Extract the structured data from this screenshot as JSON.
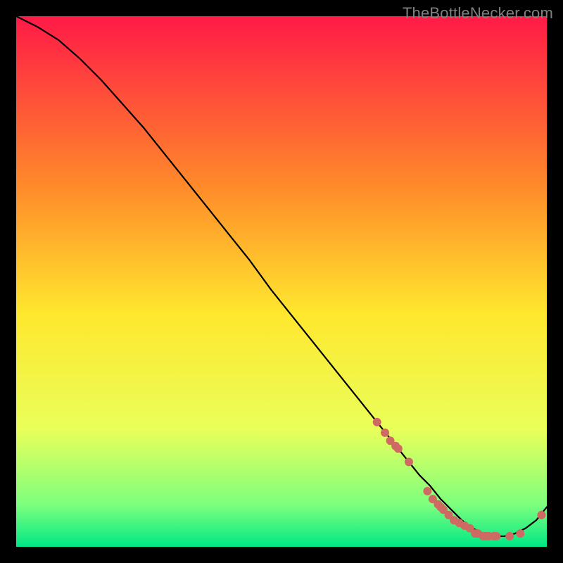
{
  "watermark": "TheBottleNecker.com",
  "colors": {
    "background": "#000000",
    "gradient_top": "#ff1a47",
    "gradient_mid_upper": "#ff8a2a",
    "gradient_mid": "#ffe72e",
    "gradient_mid_lower": "#e9ff5a",
    "gradient_lower": "#7eff7e",
    "gradient_bottom": "#00e884",
    "curve": "#000000",
    "marker": "#cf6a62"
  },
  "chart_data": {
    "type": "line",
    "title": "",
    "xlabel": "",
    "ylabel": "",
    "xlim": [
      0,
      100
    ],
    "ylim": [
      0,
      100
    ],
    "grid": false,
    "legend": false,
    "curve": {
      "x": [
        0,
        4,
        8,
        12,
        16,
        20,
        24,
        28,
        32,
        36,
        40,
        44,
        48,
        52,
        56,
        60,
        64,
        68,
        72,
        76,
        78,
        80,
        82,
        84,
        86,
        88,
        90,
        92,
        94,
        96,
        98,
        100
      ],
      "y": [
        100,
        98,
        95.5,
        92,
        88,
        83.5,
        79,
        74,
        69,
        64,
        59,
        54,
        48.5,
        43.5,
        38.5,
        33.5,
        28.5,
        23.5,
        18.5,
        13.5,
        11.5,
        9,
        7,
        5,
        3.5,
        2.5,
        2,
        2,
        2.5,
        3.5,
        5,
        7.5
      ]
    },
    "markers": {
      "x": [
        68,
        69.5,
        70.5,
        71.5,
        72,
        74,
        77.5,
        78.5,
        79.5,
        80,
        80.5,
        81.5,
        82.5,
        83.5,
        84.5,
        85.5,
        86.5,
        87,
        88,
        88.5,
        89,
        90,
        90.5,
        93,
        95,
        99
      ],
      "y": [
        23.5,
        21.5,
        20,
        19,
        18.5,
        16,
        10.5,
        9,
        8,
        7.5,
        7,
        6,
        5,
        4.5,
        4,
        3.5,
        2.5,
        2.5,
        2,
        2,
        2,
        2,
        2,
        2,
        2.5,
        6
      ]
    }
  }
}
